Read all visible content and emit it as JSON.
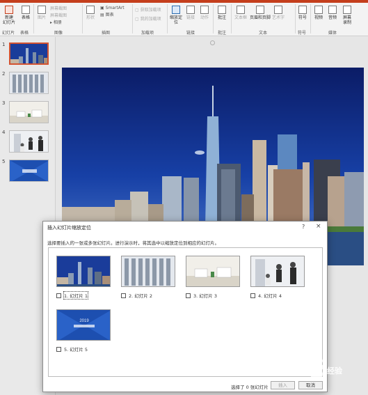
{
  "ribbon": {
    "buttons": {
      "new_slide": "新建\n幻灯片",
      "table": "表格",
      "images": "图片",
      "screenshot": "屏幕截图",
      "photo_album": "相册",
      "shapes": "形状",
      "icons": "图标",
      "smartart": "SmartArt",
      "chart": "图表",
      "get_addins": "获取加载项",
      "my_addins": "我的加载项",
      "zoom": "缩放定\n位",
      "link": "链接",
      "action": "动作",
      "comment": "批注",
      "textbox": "文本框",
      "header_footer": "页眉和页脚",
      "wordart": "艺术字",
      "symbols": "符号",
      "video": "视频",
      "audio": "音频",
      "screen_recording": "屏幕\n录制"
    },
    "groups": {
      "slides": "幻灯片",
      "tables": "表格",
      "images": "图像",
      "illustrations": "插图",
      "addins": "加载项",
      "links": "链接",
      "comments": "批注",
      "text": "文本",
      "symbols": "符号",
      "media": "媒体"
    },
    "accent_color": "#c43e1c"
  },
  "thumbnails": [
    {
      "num": "1",
      "selected": true
    },
    {
      "num": "2",
      "selected": false
    },
    {
      "num": "3",
      "selected": false
    },
    {
      "num": "4",
      "selected": false
    },
    {
      "num": "5",
      "selected": false
    }
  ],
  "dialog": {
    "title": "插入幻灯片缩放定位",
    "help": "?",
    "close": "×",
    "instruction": "选择要插入的一张或多张幻灯片。进行演示时，将其选中以缩放定位到相应的幻灯片。",
    "items": [
      {
        "label": "1. 幻灯片 1",
        "checked": false,
        "focused": true
      },
      {
        "label": "2. 幻灯片 2",
        "checked": false,
        "focused": false
      },
      {
        "label": "3. 幻灯片 3",
        "checked": false,
        "focused": false
      },
      {
        "label": "4. 幻灯片 4",
        "checked": false,
        "focused": false
      },
      {
        "label": "5. 幻灯片 5",
        "checked": false,
        "focused": false
      }
    ],
    "thumb5_text": "2019",
    "status": "选择了 0 张幻灯片",
    "insert_button": "插入",
    "cancel_button": "取消"
  },
  "watermark": {
    "brand": "Bai",
    "text": "经验"
  }
}
